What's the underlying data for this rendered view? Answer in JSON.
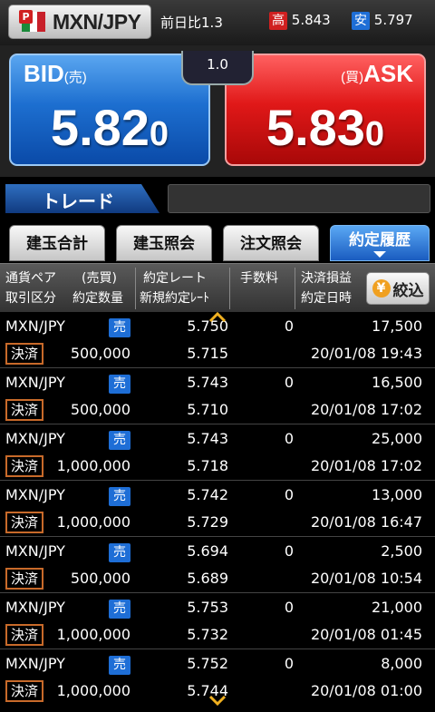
{
  "header": {
    "pair": "MXN/JPY",
    "prev_label": "前日比",
    "prev_value": "1.3",
    "high_label": "高",
    "high_value": "5.843",
    "low_label": "安",
    "low_value": "5.797"
  },
  "rates": {
    "bid_label": "BID",
    "bid_sub": "(売)",
    "bid_main": "5.82",
    "bid_last": "0",
    "ask_label": "ASK",
    "ask_sub": "(買)",
    "ask_main": "5.83",
    "ask_last": "0",
    "spread": "1.0"
  },
  "trade": {
    "title": "トレード"
  },
  "tabs": [
    {
      "label": "建玉合計"
    },
    {
      "label": "建玉照会"
    },
    {
      "label": "注文照会"
    },
    {
      "label": "約定履歴"
    }
  ],
  "columns": {
    "c1a": "通貨ペア",
    "c1b": "(売買)",
    "c2a": "取引区分",
    "c2b": "約定数量",
    "c3a": "約定レート",
    "c3b": "新規約定ﾚｰﾄ",
    "c4": "手数料",
    "c5a": "決済損益",
    "c5b": "約定日時",
    "filter": "絞込"
  },
  "rows": [
    {
      "pair": "MXN/JPY",
      "side": "売",
      "type": "決済",
      "qty": "500,000",
      "rate": "5.750",
      "new_rate": "5.715",
      "fee": "0",
      "pl": "17,500",
      "datetime": "20/01/08 19:43"
    },
    {
      "pair": "MXN/JPY",
      "side": "売",
      "type": "決済",
      "qty": "500,000",
      "rate": "5.743",
      "new_rate": "5.710",
      "fee": "0",
      "pl": "16,500",
      "datetime": "20/01/08 17:02"
    },
    {
      "pair": "MXN/JPY",
      "side": "売",
      "type": "決済",
      "qty": "1,000,000",
      "rate": "5.743",
      "new_rate": "5.718",
      "fee": "0",
      "pl": "25,000",
      "datetime": "20/01/08 17:02"
    },
    {
      "pair": "MXN/JPY",
      "side": "売",
      "type": "決済",
      "qty": "1,000,000",
      "rate": "5.742",
      "new_rate": "5.729",
      "fee": "0",
      "pl": "13,000",
      "datetime": "20/01/08 16:47"
    },
    {
      "pair": "MXN/JPY",
      "side": "売",
      "type": "決済",
      "qty": "500,000",
      "rate": "5.694",
      "new_rate": "5.689",
      "fee": "0",
      "pl": "2,500",
      "datetime": "20/01/08 10:54"
    },
    {
      "pair": "MXN/JPY",
      "side": "売",
      "type": "決済",
      "qty": "1,000,000",
      "rate": "5.753",
      "new_rate": "5.732",
      "fee": "0",
      "pl": "21,000",
      "datetime": "20/01/08 01:45"
    },
    {
      "pair": "MXN/JPY",
      "side": "売",
      "type": "決済",
      "qty": "1,000,000",
      "rate": "5.752",
      "new_rate": "5.744",
      "fee": "0",
      "pl": "8,000",
      "datetime": "20/01/08 01:00"
    }
  ],
  "colors": {
    "bid": "#1d6fd0",
    "ask": "#e01818",
    "side_badge": "#1e6ed6",
    "kessai_border": "#c86a2a",
    "chevron": "#f0b020"
  }
}
